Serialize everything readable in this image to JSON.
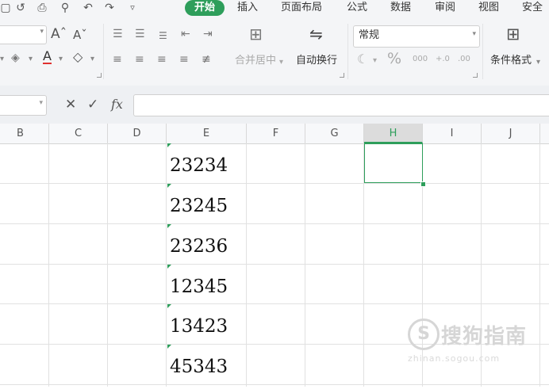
{
  "menu": {
    "start": "开始",
    "insert": "插入",
    "page_layout": "页面布局",
    "formulas": "公式",
    "data": "数据",
    "review": "审阅",
    "view": "视图",
    "security": "安全"
  },
  "ribbon": {
    "merge_center": "合并居中",
    "wrap_text": "自动换行",
    "number_format": "常规",
    "conditional_format": "条件格式",
    "percent": "%",
    "thousands": "000",
    "inc_decimal": "+.0",
    "dec_decimal": ".00"
  },
  "formula_bar": {
    "fx_label": "fx",
    "value": ""
  },
  "columns": [
    "B",
    "C",
    "D",
    "E",
    "F",
    "G",
    "H",
    "I",
    "J"
  ],
  "selected_column": "H",
  "column_e_values": [
    "23234",
    "23245",
    "23236",
    "12345",
    "13423",
    "45343"
  ],
  "watermark": {
    "symbol": "S",
    "text": "搜狗指南",
    "url": "zhinan.sogou.com"
  },
  "colors": {
    "accent": "#2e9e5b",
    "error_indicator": "#2e9e5b"
  }
}
